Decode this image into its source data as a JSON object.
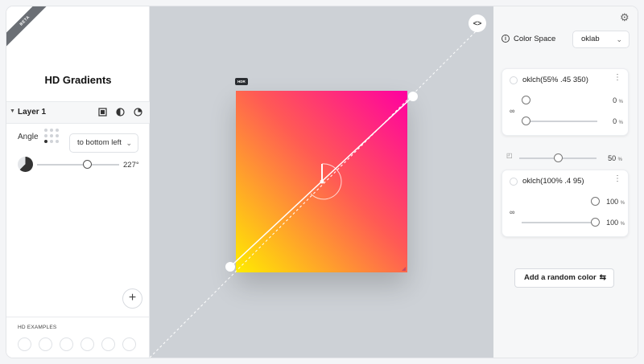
{
  "app": {
    "title": "HD Gradients",
    "badge": "BETA"
  },
  "layer": {
    "name": "Layer 1",
    "icons": [
      "layout-icon",
      "contrast-icon",
      "pie-chart-icon"
    ]
  },
  "angle": {
    "label": "Angle",
    "direction": "to bottom left",
    "value": "227°",
    "degrees": 227
  },
  "add_button": "+",
  "examples": {
    "label": "HD EXAMPLES",
    "count": 6
  },
  "canvas": {
    "hdr_badge": "HDR",
    "code_button": "<>"
  },
  "gradient": {
    "from": "#ff00a0",
    "mid": "#ff5a55",
    "to": "#ffec00"
  },
  "settings": {
    "color_space_label": "Color Space",
    "color_space_value": "oklab"
  },
  "stops": [
    {
      "name": "oklch(55% .45 350)",
      "slider1": "0",
      "slider2": "0",
      "unit": "%"
    },
    {
      "name": "oklch(100% .4 95)",
      "slider1": "100",
      "slider2": "100",
      "unit": "%"
    }
  ],
  "midpoint": {
    "value": "50",
    "unit": "%"
  },
  "random_button": "Add a random color"
}
